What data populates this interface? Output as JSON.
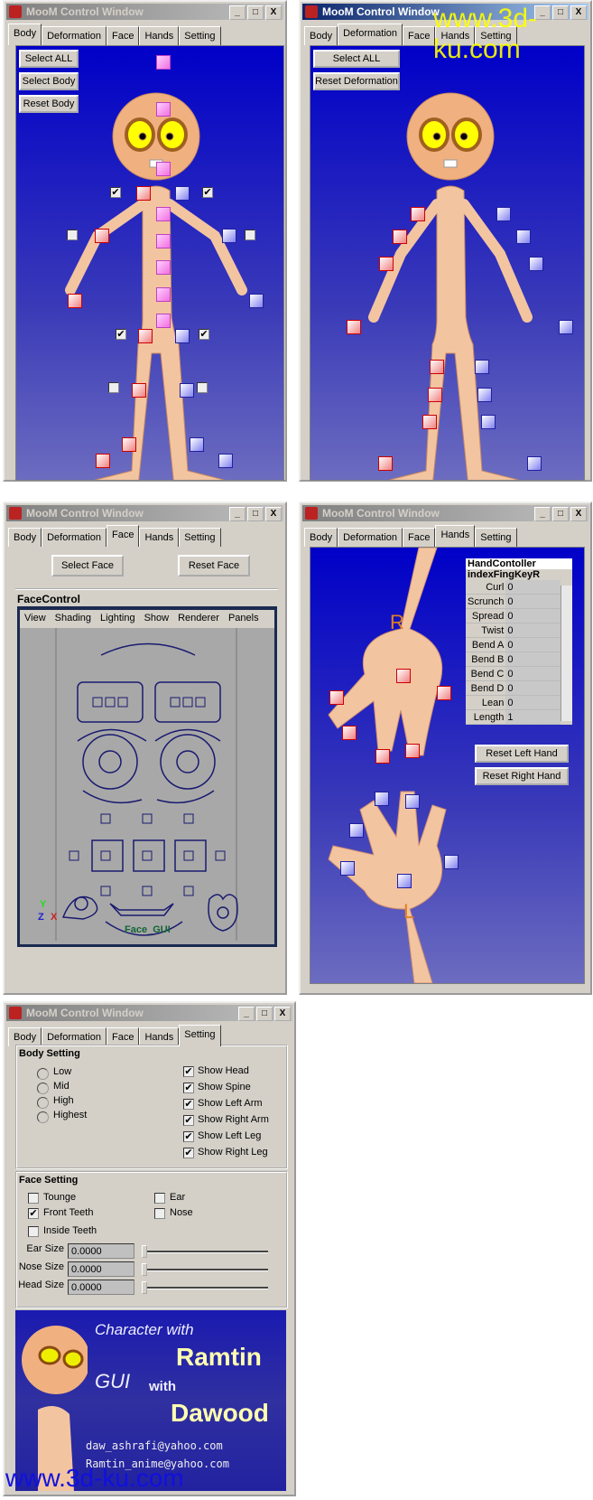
{
  "window_title": "MooM Control Window",
  "window_buttons": {
    "minimize": "_",
    "maximize": "□",
    "close": "X"
  },
  "tabs": [
    "Body",
    "Deformation",
    "Face",
    "Hands",
    "Setting"
  ],
  "body_tab": {
    "select_all": "Select ALL",
    "select_body": "Select Body",
    "reset_body": "Reset Body"
  },
  "deformation_tab": {
    "select_all": "Select ALL",
    "reset_deformation": "Reset Deformation"
  },
  "face_tab": {
    "select_face": "Select Face",
    "reset_face": "Reset Face",
    "panel_title": "FaceControl",
    "menu": [
      "View",
      "Shading",
      "Lighting",
      "Show",
      "Renderer",
      "Panels"
    ],
    "viewport_label": "Face_GUI",
    "axis": {
      "y": "Y",
      "z": "Z",
      "x": "X"
    }
  },
  "hands_tab": {
    "label_right": "R",
    "label_left": "L",
    "controller_title": "HandContoller",
    "node": "indexFingKeyR",
    "attributes": [
      {
        "name": "Curl",
        "value": "0"
      },
      {
        "name": "Scrunch",
        "value": "0"
      },
      {
        "name": "Spread",
        "value": "0"
      },
      {
        "name": "Twist",
        "value": "0"
      },
      {
        "name": "Bend A",
        "value": "0"
      },
      {
        "name": "Bend B",
        "value": "0"
      },
      {
        "name": "Bend C",
        "value": "0"
      },
      {
        "name": "Bend D",
        "value": "0"
      },
      {
        "name": "Lean",
        "value": "0"
      },
      {
        "name": "Length",
        "value": "1"
      }
    ],
    "reset_left": "Reset Left Hand",
    "reset_right": "Reset Right Hand"
  },
  "setting_tab": {
    "body_setting": {
      "title": "Body Setting",
      "resolution": [
        {
          "label": "Low",
          "selected": false
        },
        {
          "label": "Mid",
          "selected": false
        },
        {
          "label": "High",
          "selected": false
        },
        {
          "label": "Highest",
          "selected": false
        }
      ],
      "show": [
        {
          "label": "Show Head",
          "checked": true
        },
        {
          "label": "Show Spine",
          "checked": true
        },
        {
          "label": "Show Left Arm",
          "checked": true
        },
        {
          "label": "Show Right Arm",
          "checked": true
        },
        {
          "label": "Show Left Leg",
          "checked": true
        },
        {
          "label": "Show Right Leg",
          "checked": true
        }
      ]
    },
    "face_setting": {
      "title": "Face Setting",
      "options": [
        {
          "label": "Tounge",
          "checked": false
        },
        {
          "label": "Front Teeth",
          "checked": true
        },
        {
          "label": "Inside Teeth",
          "checked": false
        },
        {
          "label": "Ear",
          "checked": false
        },
        {
          "label": "Nose",
          "checked": false
        }
      ],
      "sliders": [
        {
          "label": "Ear Size",
          "value": "0.0000"
        },
        {
          "label": "Nose Size",
          "value": "0.0000"
        },
        {
          "label": "Head Size",
          "value": "0.0000"
        }
      ]
    }
  },
  "banner": {
    "line1": "Character with",
    "name1": "Ramtin",
    "line2a": "GUI",
    "line2b": "with",
    "name2": "Dawood",
    "email1": "daw_ashrafi@yahoo.com",
    "email2": "Ramtin_anime@yahoo.com"
  },
  "watermark": "www.3d-ku.com",
  "colors": {
    "title_active": "#0a246a",
    "panel_blue": "#0000c8",
    "window_bg": "#d4d0c8",
    "left_control": "#f08080",
    "right_control": "#8080f0",
    "spine_control": "#f070e0"
  }
}
